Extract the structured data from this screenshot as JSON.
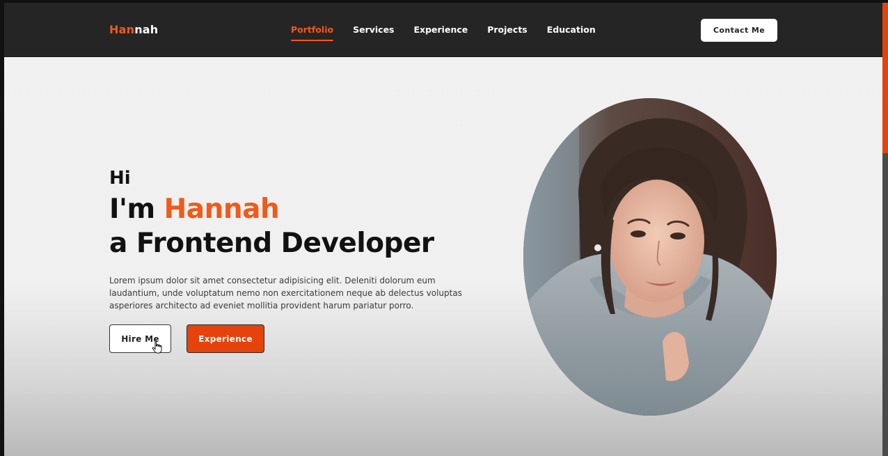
{
  "nav": {
    "logo_part1": "Han",
    "logo_part2": "nah",
    "links": [
      "Portfolio",
      "Services",
      "Experience",
      "Projects",
      "Education"
    ],
    "active_link": "Portfolio",
    "contact_label": "Contact Me"
  },
  "hero": {
    "greeting": "Hi",
    "name_prefix": "I'm ",
    "name": "Hannah",
    "role": "a Frontend Developer",
    "description": "Lorem ipsum dolor sit amet consectetur adipisicing elit. Deleniti dolorum eum laudantium, unde voluptatum nemo non exercitationem neque ab delectus voluptas asperiores architecto ad eveniet mollitia provident harum pariatur porro.",
    "hire_label": "Hire Me",
    "experience_label": "Experience"
  },
  "colors": {
    "accent": "#f05a1a",
    "button_accent": "#e6420c",
    "navbar_bg": "#252525",
    "page_bg": "#f1f1f1"
  },
  "icons": {
    "cursor": "hand-pointer-icon"
  }
}
